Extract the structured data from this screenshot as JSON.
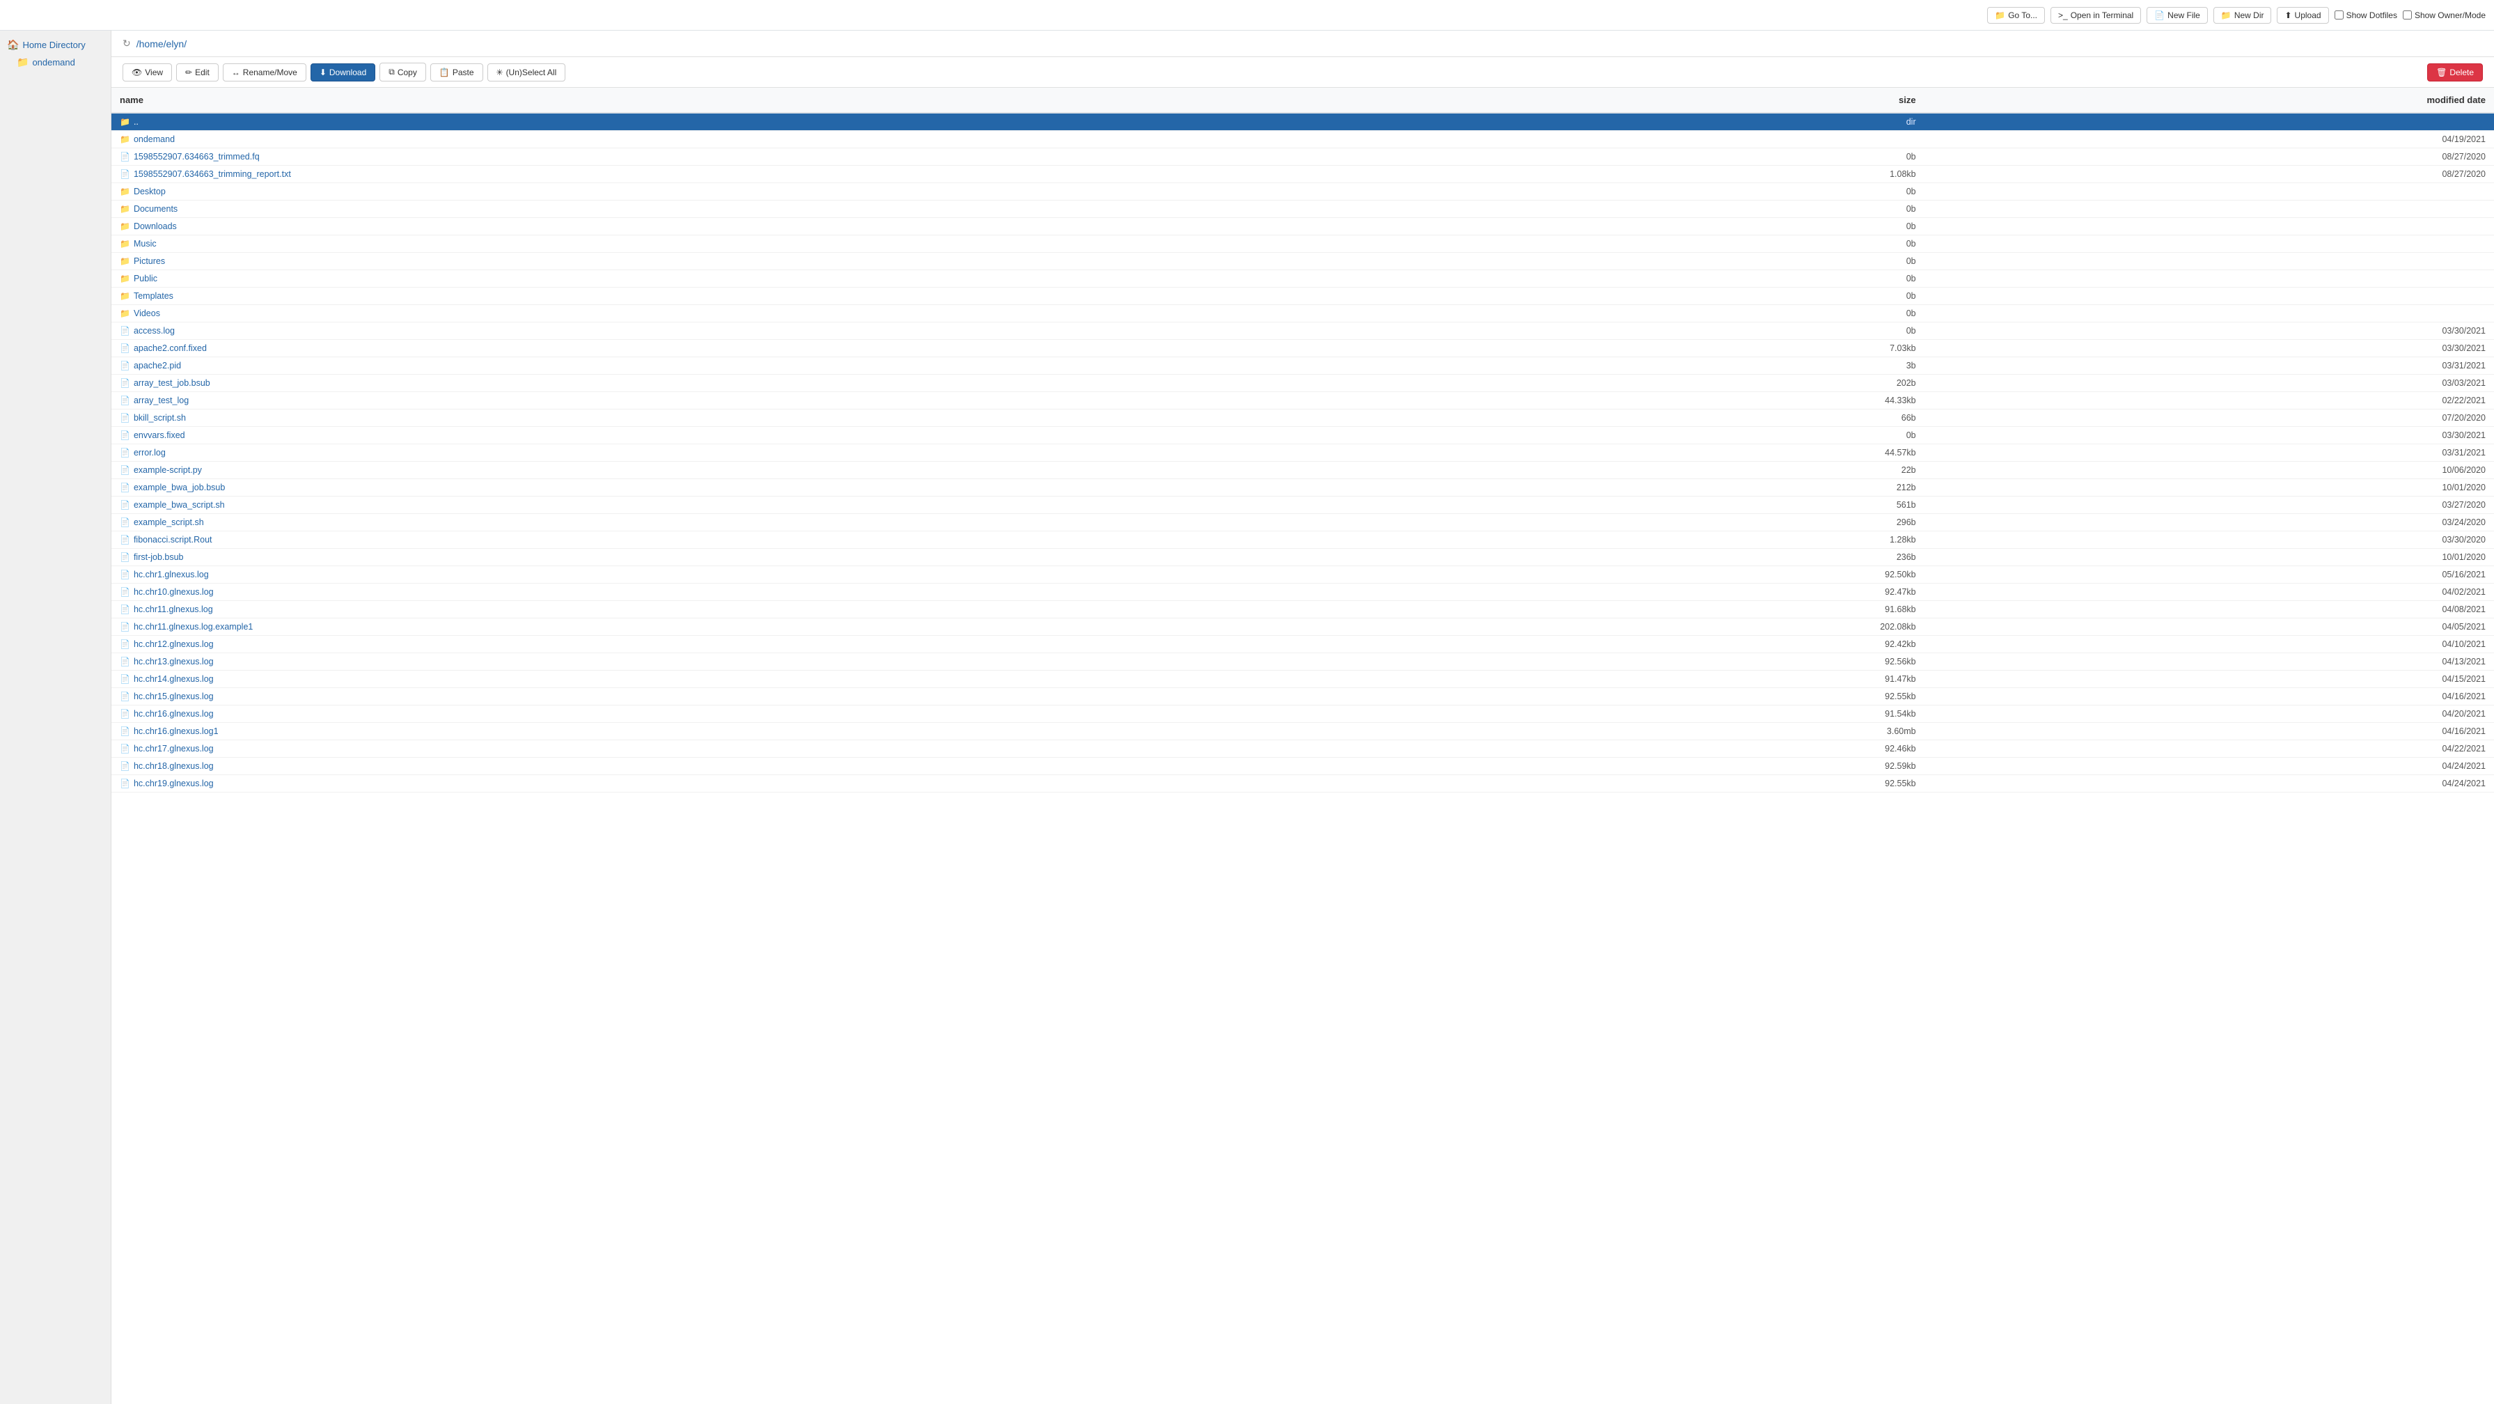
{
  "topToolbar": {
    "goTo": "Go To...",
    "openInTerminal": "Open in Terminal",
    "newFile": "New File",
    "newDir": "New Dir",
    "upload": "Upload",
    "showDotfiles": "Show Dotfiles",
    "showOwnerMode": "Show Owner/Mode"
  },
  "sidebar": {
    "homeDirectory": "Home Directory",
    "ondemand": "ondemand"
  },
  "pathBar": {
    "path": "/home/elyn/"
  },
  "actionToolbar": {
    "view": "View",
    "edit": "Edit",
    "renameMove": "Rename/Move",
    "download": "Download",
    "copy": "Copy",
    "paste": "Paste",
    "selectAll": "(Un)Select All",
    "delete": "Delete"
  },
  "tableHeaders": {
    "name": "name",
    "size": "size",
    "modifiedDate": "modified date"
  },
  "files": [
    {
      "name": "..",
      "type": "dir",
      "size": "dir",
      "date": ""
    },
    {
      "name": "ondemand",
      "type": "dir",
      "size": "",
      "date": "04/19/2021"
    },
    {
      "name": "1598552907.634663_trimmed.fq",
      "type": "file",
      "size": "0b",
      "date": "08/27/2020"
    },
    {
      "name": "1598552907.634663_trimming_report.txt",
      "type": "file",
      "size": "1.08kb",
      "date": "08/27/2020"
    },
    {
      "name": "Desktop",
      "type": "dir",
      "size": "0b",
      "date": ""
    },
    {
      "name": "Documents",
      "type": "dir",
      "size": "0b",
      "date": ""
    },
    {
      "name": "Downloads",
      "type": "dir",
      "size": "0b",
      "date": ""
    },
    {
      "name": "Music",
      "type": "dir",
      "size": "0b",
      "date": ""
    },
    {
      "name": "Pictures",
      "type": "dir",
      "size": "0b",
      "date": ""
    },
    {
      "name": "Public",
      "type": "dir",
      "size": "0b",
      "date": ""
    },
    {
      "name": "Templates",
      "type": "dir",
      "size": "0b",
      "date": ""
    },
    {
      "name": "Videos",
      "type": "dir",
      "size": "0b",
      "date": ""
    },
    {
      "name": "access.log",
      "type": "file",
      "size": "0b",
      "date": "03/30/2021"
    },
    {
      "name": "apache2.conf.fixed",
      "type": "file",
      "size": "7.03kb",
      "date": "03/30/2021"
    },
    {
      "name": "apache2.pid",
      "type": "file",
      "size": "3b",
      "date": "03/31/2021"
    },
    {
      "name": "array_test_job.bsub",
      "type": "file",
      "size": "202b",
      "date": "03/03/2021"
    },
    {
      "name": "array_test_log",
      "type": "file",
      "size": "44.33kb",
      "date": "02/22/2021"
    },
    {
      "name": "bkill_script.sh",
      "type": "file",
      "size": "66b",
      "date": "07/20/2020"
    },
    {
      "name": "envvars.fixed",
      "type": "file",
      "size": "0b",
      "date": "03/30/2021"
    },
    {
      "name": "error.log",
      "type": "file",
      "size": "44.57kb",
      "date": "03/31/2021"
    },
    {
      "name": "example-script.py",
      "type": "file",
      "size": "22b",
      "date": "10/06/2020"
    },
    {
      "name": "example_bwa_job.bsub",
      "type": "file",
      "size": "212b",
      "date": "10/01/2020"
    },
    {
      "name": "example_bwa_script.sh",
      "type": "file",
      "size": "561b",
      "date": "03/27/2020"
    },
    {
      "name": "example_script.sh",
      "type": "file",
      "size": "296b",
      "date": "03/24/2020"
    },
    {
      "name": "fibonacci.script.Rout",
      "type": "file",
      "size": "1.28kb",
      "date": "03/30/2020"
    },
    {
      "name": "first-job.bsub",
      "type": "file",
      "size": "236b",
      "date": "10/01/2020"
    },
    {
      "name": "hc.chr1.glnexus.log",
      "type": "file",
      "size": "92.50kb",
      "date": "05/16/2021"
    },
    {
      "name": "hc.chr10.glnexus.log",
      "type": "file",
      "size": "92.47kb",
      "date": "04/02/2021"
    },
    {
      "name": "hc.chr11.glnexus.log",
      "type": "file",
      "size": "91.68kb",
      "date": "04/08/2021"
    },
    {
      "name": "hc.chr11.glnexus.log.example1",
      "type": "file",
      "size": "202.08kb",
      "date": "04/05/2021"
    },
    {
      "name": "hc.chr12.glnexus.log",
      "type": "file",
      "size": "92.42kb",
      "date": "04/10/2021"
    },
    {
      "name": "hc.chr13.glnexus.log",
      "type": "file",
      "size": "92.56kb",
      "date": "04/13/2021"
    },
    {
      "name": "hc.chr14.glnexus.log",
      "type": "file",
      "size": "91.47kb",
      "date": "04/15/2021"
    },
    {
      "name": "hc.chr15.glnexus.log",
      "type": "file",
      "size": "92.55kb",
      "date": "04/16/2021"
    },
    {
      "name": "hc.chr16.glnexus.log",
      "type": "file",
      "size": "91.54kb",
      "date": "04/20/2021"
    },
    {
      "name": "hc.chr16.glnexus.log1",
      "type": "file",
      "size": "3.60mb",
      "date": "04/16/2021"
    },
    {
      "name": "hc.chr17.glnexus.log",
      "type": "file",
      "size": "92.46kb",
      "date": "04/22/2021"
    },
    {
      "name": "hc.chr18.glnexus.log",
      "type": "file",
      "size": "92.59kb",
      "date": "04/24/2021"
    },
    {
      "name": "hc.chr19.glnexus.log",
      "type": "file",
      "size": "92.55kb",
      "date": "04/24/2021"
    }
  ]
}
